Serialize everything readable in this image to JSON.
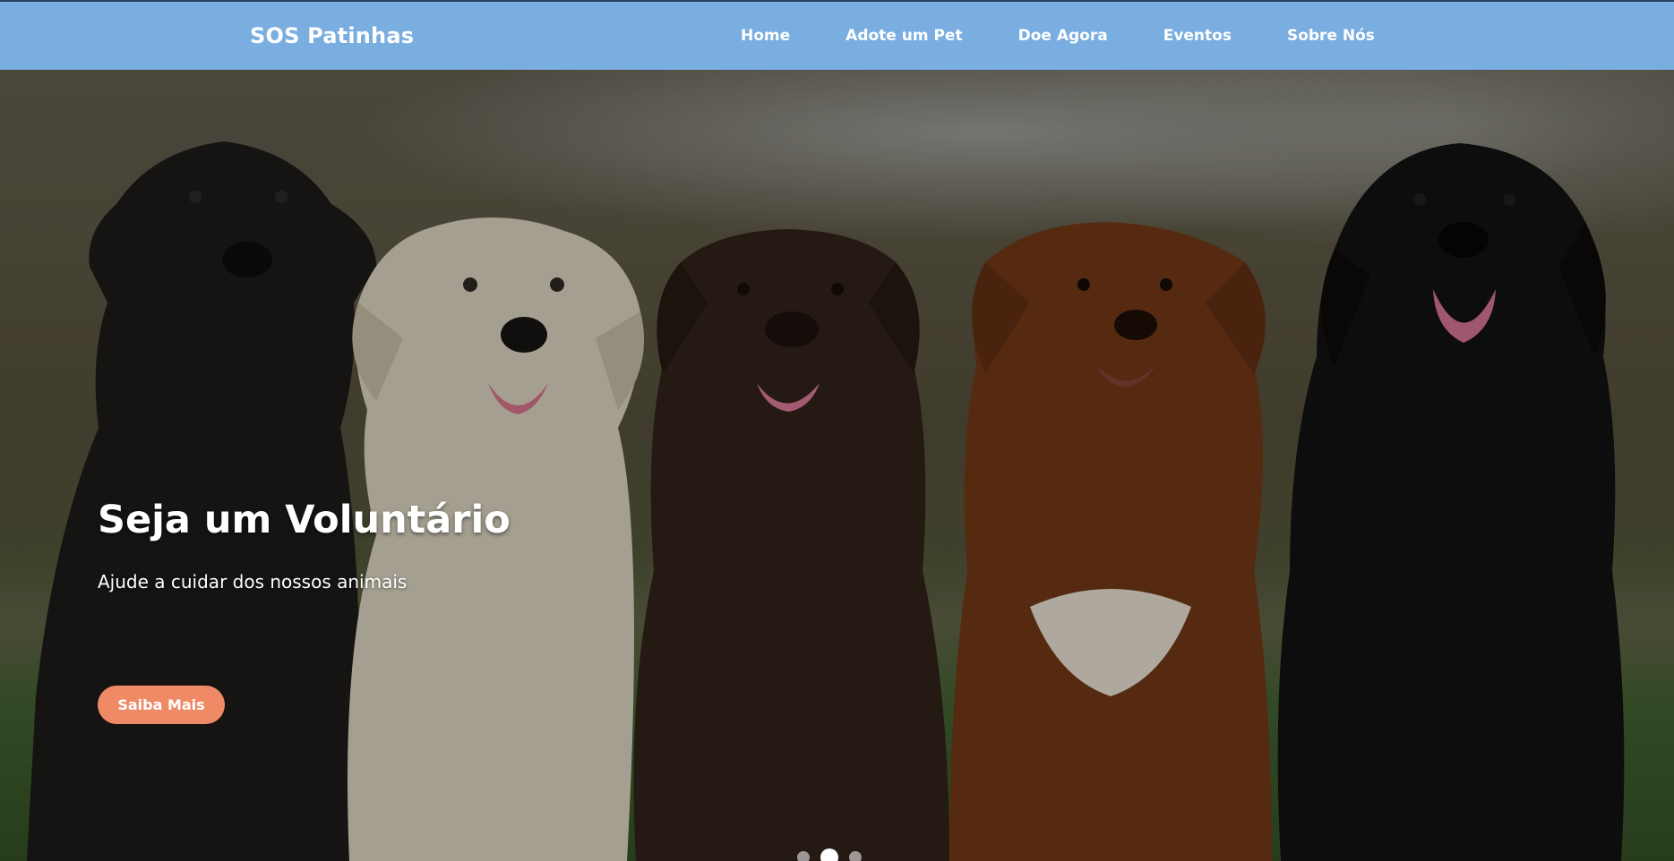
{
  "brand": "SOS Patinhas",
  "nav": {
    "items": [
      {
        "label": "Home"
      },
      {
        "label": "Adote um Pet"
      },
      {
        "label": "Doe Agora"
      },
      {
        "label": "Eventos"
      },
      {
        "label": "Sobre Nós"
      }
    ]
  },
  "hero": {
    "title": "Seja um Voluntário",
    "subtitle": "Ajude a cuidar dos nossos animais",
    "button_label": "Saiba Mais",
    "image_semantic": "five-dogs-sitting-photo",
    "carousel": {
      "slide_count": 3,
      "active_index": 1
    }
  },
  "colors": {
    "navbar": "#7aaee0",
    "accent_button": "#f08a66",
    "text": "#ffffff"
  }
}
